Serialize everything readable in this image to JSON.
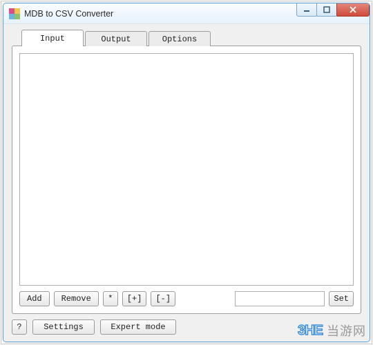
{
  "window": {
    "title": "MDB to CSV Converter"
  },
  "tabs": {
    "input": "Input",
    "output": "Output",
    "options": "Options"
  },
  "toolbar": {
    "add": "Add",
    "remove": "Remove",
    "star": "*",
    "plus": "[+]",
    "minus": "[-]",
    "set": "Set"
  },
  "bottom": {
    "help": "?",
    "settings": "Settings",
    "expert": "Expert mode"
  },
  "watermark": {
    "logo": "3HE",
    "text": "当游网"
  },
  "input_value": ""
}
